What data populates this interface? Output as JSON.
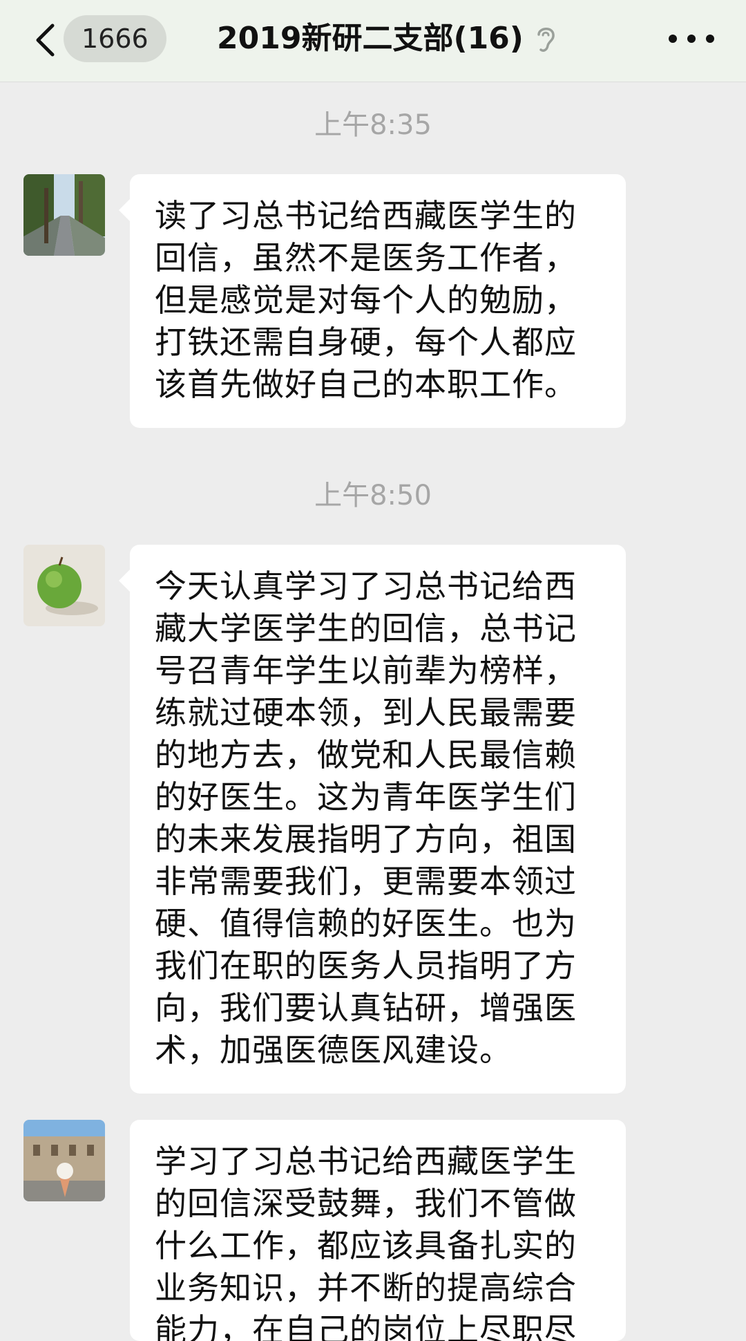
{
  "header": {
    "unread_count": "1666",
    "title": "2019新研二支部(16)",
    "back_icon": "chevron-left-icon",
    "mute_icon": "ear-mute-icon",
    "more_icon": "more-dots-icon"
  },
  "messages": [
    {
      "timestamp": "上午8:35",
      "avatar": "tree-road-photo-avatar",
      "text": "读了习总书记给西藏医学生的回信，虽然不是医务工作者，但是感觉是对每个人的勉励，打铁还需自身硬，每个人都应该首先做好自己的本职工作。"
    },
    {
      "timestamp": "上午8:50",
      "avatar": "green-apple-avatar",
      "text": "今天认真学习了习总书记给西藏大学医学生的回信，总书记号召青年学生以前辈为榜样，练就过硬本领，到人民最需要的地方去，做党和人民最信赖的好医生。这为青年医学生们的未来发展指明了方向，祖国非常需要我们，更需要本领过硬、值得信赖的好医生。也为我们在职的医务人员指明了方向，我们要认真钻研，增强医术，加强医德医风建设。"
    },
    {
      "timestamp": "",
      "avatar": "campus-icecream-avatar",
      "text": "学习了习总书记给西藏医学生的回信深受鼓舞，我们不管做什么工作，都应该具备扎实的业务知识，并不断的提高综合能力，在自己的岗位上尽职尽"
    }
  ],
  "colors": {
    "background": "#ededed",
    "bubble": "#ffffff",
    "header": "#eef3ec",
    "timestamp": "#a6a6a6"
  }
}
